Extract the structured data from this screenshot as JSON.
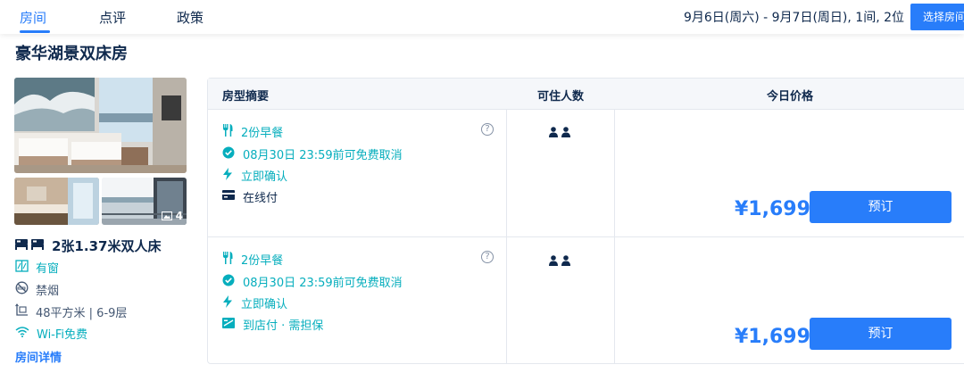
{
  "tabs": [
    {
      "label": "房间",
      "active": true
    },
    {
      "label": "点评",
      "active": false
    },
    {
      "label": "政策",
      "active": false
    }
  ],
  "stay": {
    "dates": "9月6日(周六) - 9月7日(周日), 1间, 2位"
  },
  "select_room_button": "选择房间",
  "room": {
    "name": "豪华湖景双床房",
    "photo_count": "4",
    "bed": "2张1.37米双人床",
    "features": [
      {
        "icon": "window-icon",
        "label": "有窗"
      },
      {
        "icon": "no-smoking-icon",
        "label": "禁烟"
      },
      {
        "icon": "area-icon",
        "label": "48平方米 | 6-9层"
      },
      {
        "icon": "wifi-icon",
        "label": "Wi-Fi免费"
      }
    ],
    "details_link": "房间详情"
  },
  "table": {
    "headers": {
      "summary": "房型摘要",
      "occupancy": "可住人数",
      "price": "今日价格"
    },
    "offers": [
      {
        "meal": "2份早餐",
        "cancel": "08月30日 23:59前可免费取消",
        "confirm": "立即确认",
        "payment": "在线付",
        "price": "¥1,699",
        "book": "预订"
      },
      {
        "meal": "2份早餐",
        "cancel": "08月30日 23:59前可免费取消",
        "confirm": "立即确认",
        "payment": "到店付 · 需担保",
        "price": "¥1,699",
        "book": "预订"
      }
    ]
  },
  "colors": {
    "accent": "#287dfa",
    "teal": "#06aebd",
    "text": "#0f294d"
  }
}
